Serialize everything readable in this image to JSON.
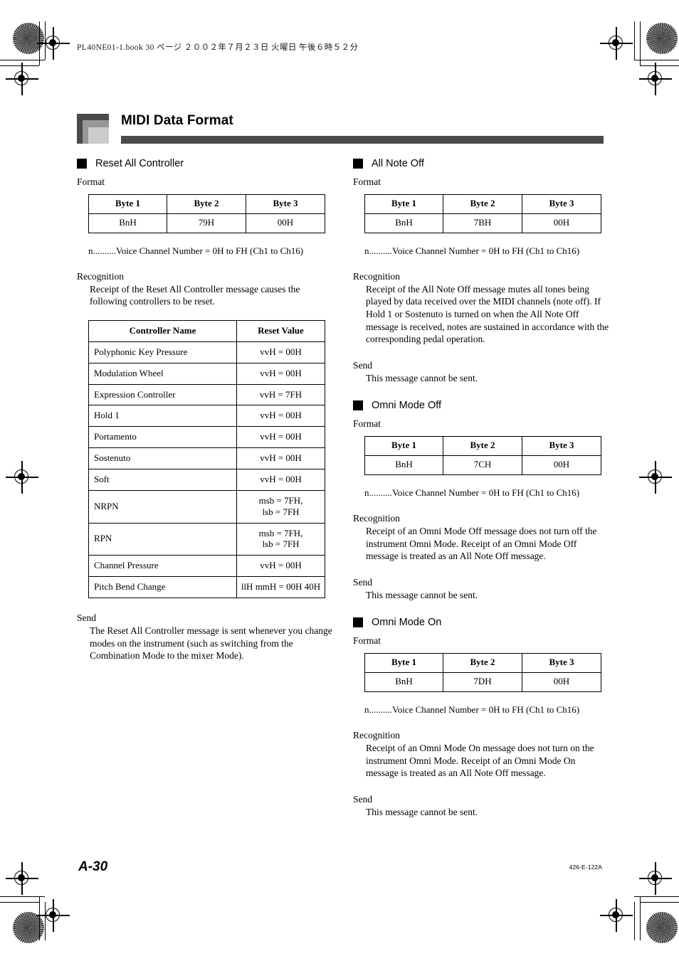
{
  "file_header": "PL40NE01-1.book   30 ページ   ２００２年７月２３日   火曜日   午後６時５２分",
  "title": "MIDI Data Format",
  "footer": {
    "page_number": "A-30",
    "doc_code": "426-E-122A"
  },
  "labels": {
    "format": "Format",
    "recognition": "Recognition",
    "send": "Send",
    "note": "n..........Voice Channel Number = 0H to FH (Ch1 to Ch16)"
  },
  "byte_headers": [
    "Byte 1",
    "Byte 2",
    "Byte 3"
  ],
  "left_column": {
    "section": {
      "title": "Reset All Controller",
      "format_row": [
        "BnH",
        "79H",
        "00H"
      ],
      "recognition": "Receipt of the Reset All Controller message causes the following controllers to be reset.",
      "controller_table": {
        "headers": [
          "Controller Name",
          "Reset Value"
        ],
        "rows": [
          {
            "name": "Polyphonic Key Pressure",
            "value": "vvH = 00H"
          },
          {
            "name": "Modulation Wheel",
            "value": "vvH = 00H"
          },
          {
            "name": "Expression Controller",
            "value": "vvH = 7FH"
          },
          {
            "name": "Hold 1",
            "value": "vvH = 00H"
          },
          {
            "name": "Portamento",
            "value": "vvH = 00H"
          },
          {
            "name": "Sostenuto",
            "value": "vvH = 00H"
          },
          {
            "name": "Soft",
            "value": "vvH = 00H"
          },
          {
            "name": "NRPN",
            "value": "msb = 7FH,\nlsb = 7FH"
          },
          {
            "name": "RPN",
            "value": "msb = 7FH,\nlsb = 7FH"
          },
          {
            "name": "Channel Pressure",
            "value": "vvH = 00H"
          },
          {
            "name": "Pitch Bend Change",
            "value": "llH mmH = 00H 40H"
          }
        ]
      },
      "send": "The Reset All Controller message is sent whenever you change modes on the instrument (such as switching from the Combination Mode to the mixer Mode)."
    }
  },
  "right_column": {
    "sections": [
      {
        "title": "All Note Off",
        "format_row": [
          "BnH",
          "7BH",
          "00H"
        ],
        "recognition": "Receipt of the All Note Off message mutes all tones being played by data received over the MIDI channels (note off). If Hold 1 or Sostenuto is turned on when the All Note Off message is received, notes are sustained in accordance with the corresponding pedal operation.",
        "send": "This message cannot be sent."
      },
      {
        "title": "Omni Mode Off",
        "format_row": [
          "BnH",
          "7CH",
          "00H"
        ],
        "recognition": "Receipt of an Omni Mode Off message does not turn off the instrument Omni Mode. Receipt of an Omni Mode Off message is treated as an All Note Off message.",
        "send": "This message cannot be sent."
      },
      {
        "title": "Omni Mode On",
        "format_row": [
          "BnH",
          "7DH",
          "00H"
        ],
        "recognition": "Receipt of an Omni Mode On message does not turn on the instrument Omni Mode. Receipt of an Omni Mode On message is treated as an All Note Off message.",
        "send": "This message cannot be sent."
      }
    ]
  }
}
